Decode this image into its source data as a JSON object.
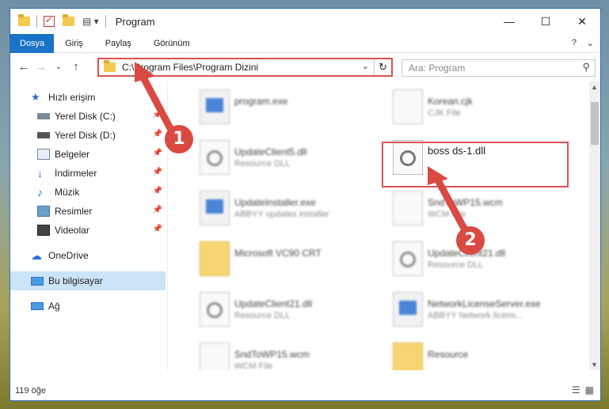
{
  "window": {
    "title": "Program",
    "controls": {
      "minimize": "—",
      "maximize": "☐",
      "close": "✕"
    }
  },
  "ribbon": {
    "tabs": [
      "Dosya",
      "Giriş",
      "Paylaş",
      "Görünüm"
    ],
    "expand": "⌄",
    "help": "?"
  },
  "address": {
    "path": "C:\\Program Files\\Program Dizini",
    "search_placeholder": "Ara: Program"
  },
  "nav": {
    "back": "←",
    "forward": "→",
    "recent": "⌄",
    "up": "↑",
    "items": [
      {
        "label": "Hızlı erişim",
        "pinned": false
      },
      {
        "label": "Yerel Disk (C:)",
        "pinned": true
      },
      {
        "label": "Yerel Disk (D:)",
        "pinned": true
      },
      {
        "label": "Belgeler",
        "pinned": true
      },
      {
        "label": "İndirmeler",
        "pinned": true
      },
      {
        "label": "Müzik",
        "pinned": true
      },
      {
        "label": "Resimler",
        "pinned": true
      },
      {
        "label": "Videolar",
        "pinned": true
      },
      {
        "label": "OneDrive",
        "pinned": false
      },
      {
        "label": "Bu bilgisayar",
        "pinned": false
      },
      {
        "label": "Ağ",
        "pinned": false
      }
    ]
  },
  "files": [
    {
      "name": "program.exe",
      "desc": "",
      "icon": "exe-icon"
    },
    {
      "name": "Korean.cjk",
      "desc": "CJK File",
      "icon": "file-icon"
    },
    {
      "name": "UpdateClient5.dll",
      "desc": "Resource DLL",
      "icon": "dll-icon"
    },
    {
      "name": "boss ds-1.dll",
      "desc": "",
      "icon": "dll-icon"
    },
    {
      "name": "UpdateInstaller.exe",
      "desc": "ABBYY updates installer",
      "icon": "exe-icon"
    },
    {
      "name": "SndToWP15.wcm",
      "desc": "WCM File",
      "icon": "file-icon"
    },
    {
      "name": "Microsoft VC90 CRT",
      "desc": "",
      "icon": "folder-icon"
    },
    {
      "name": "UpdateClient21.dll",
      "desc": "Resource DLL",
      "icon": "dll-icon"
    },
    {
      "name": "UpdateClient21.dll",
      "desc": "Resource DLL",
      "icon": "dll-icon"
    },
    {
      "name": "NetworkLicenseServer.exe",
      "desc": "ABBYY Network licens...",
      "icon": "exe-icon"
    },
    {
      "name": "SndToWP15.wcm",
      "desc": "WCM File",
      "icon": "file-icon"
    },
    {
      "name": "Resource",
      "desc": "",
      "icon": "folder-icon"
    }
  ],
  "status": {
    "count": "119 öğe"
  },
  "callouts": [
    "1",
    "2"
  ],
  "colors": {
    "accent": "#1a73c7",
    "highlight": "#d9534f"
  }
}
